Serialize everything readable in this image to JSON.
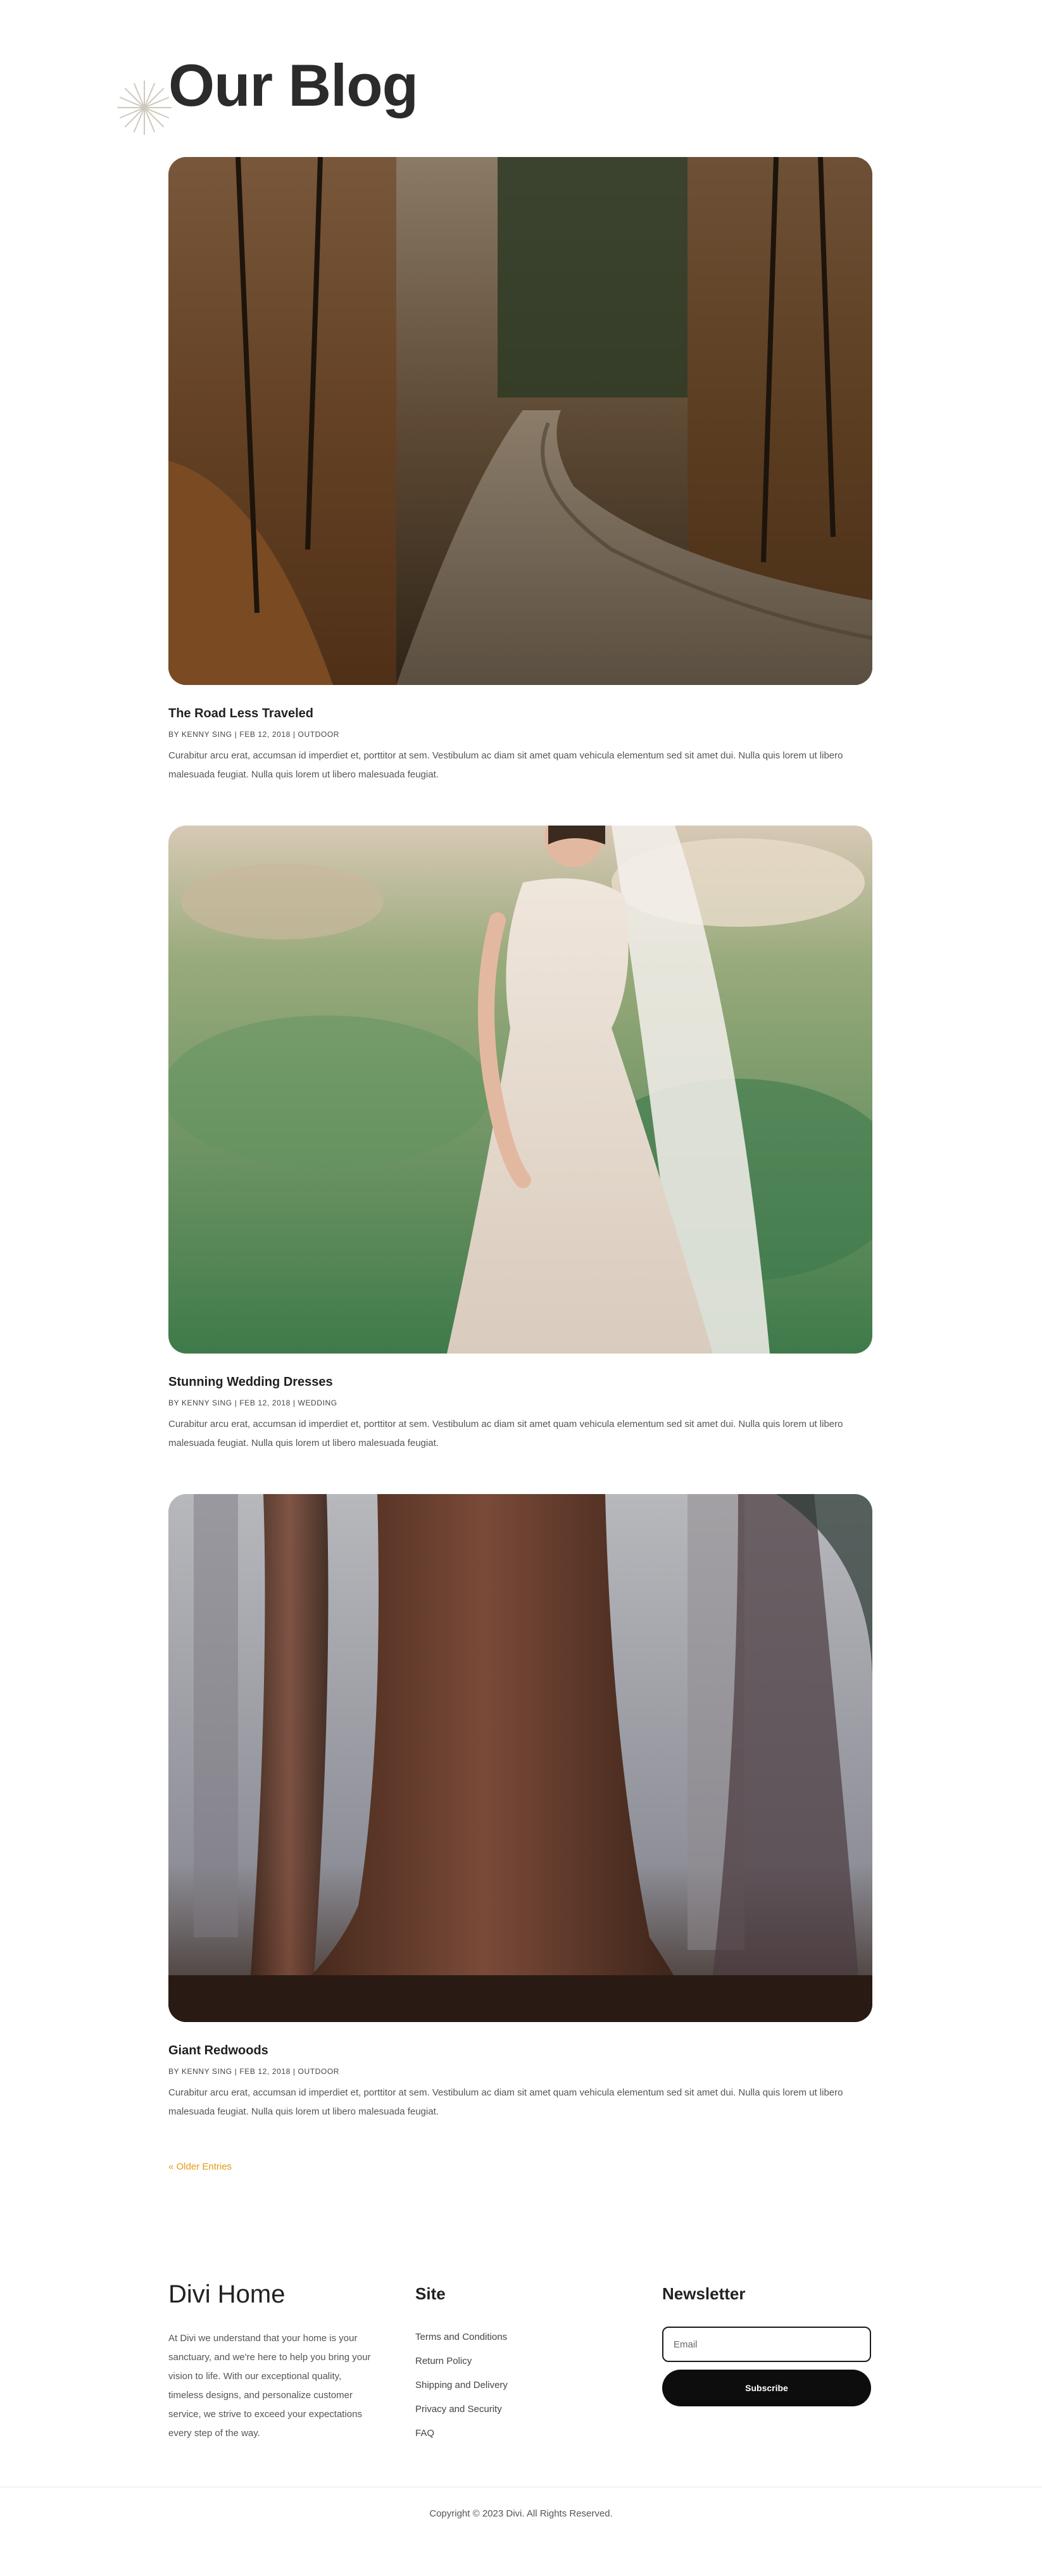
{
  "page": {
    "title": "Our Blog"
  },
  "posts": [
    {
      "title": "The Road Less Traveled",
      "author": "BY KENNY SING",
      "date": "FEB 12, 2018",
      "category": "OUTDOOR",
      "excerpt": "Curabitur arcu erat, accumsan id imperdiet et, porttitor at sem. Vestibulum ac diam sit amet quam vehicula elementum sed sit amet dui. Nulla quis lorem ut libero malesuada feugiat. Nulla quis lorem ut libero malesuada feugiat.",
      "image": "autumn forest dirt road"
    },
    {
      "title": "Stunning Wedding Dresses",
      "author": "BY KENNY SING",
      "date": "FEB 12, 2018",
      "category": "WEDDING",
      "excerpt": "Curabitur arcu erat, accumsan id imperdiet et, porttitor at sem. Vestibulum ac diam sit amet quam vehicula elementum sed sit amet dui. Nulla quis lorem ut libero malesuada feugiat. Nulla quis lorem ut libero malesuada feugiat.",
      "image": "bride in lace dress on grass"
    },
    {
      "title": "Giant Redwoods",
      "author": "BY KENNY SING",
      "date": "FEB 12, 2018",
      "category": "OUTDOOR",
      "excerpt": "Curabitur arcu erat, accumsan id imperdiet et, porttitor at sem. Vestibulum ac diam sit amet quam vehicula elementum sed sit amet dui. Nulla quis lorem ut libero malesuada feugiat. Nulla quis lorem ut libero malesuada feugiat.",
      "image": "giant redwood trees in fog"
    }
  ],
  "pagination": {
    "older_entries": "« Older Entries"
  },
  "footer": {
    "brand": "Divi Home",
    "about": "At Divi we understand that your home is your sanctuary, and we're here to help you bring your vision to life. With our exceptional quality, timeless designs, and personalize customer service, we strive to exceed your expectations every step of the way.",
    "site_heading": "Site",
    "site_links": [
      "Terms and Conditions",
      "Return Policy",
      "Shipping and Delivery",
      "Privacy and Security",
      "FAQ"
    ],
    "newsletter_heading": "Newsletter",
    "email_placeholder": "Email",
    "subscribe_label": "Subscribe",
    "copyright": "Copyright © 2023 Divi. All Rights Reserved."
  },
  "colors": {
    "accent": "#e39b14",
    "button": "#0d0d0d",
    "text": "#2b2b2b"
  }
}
